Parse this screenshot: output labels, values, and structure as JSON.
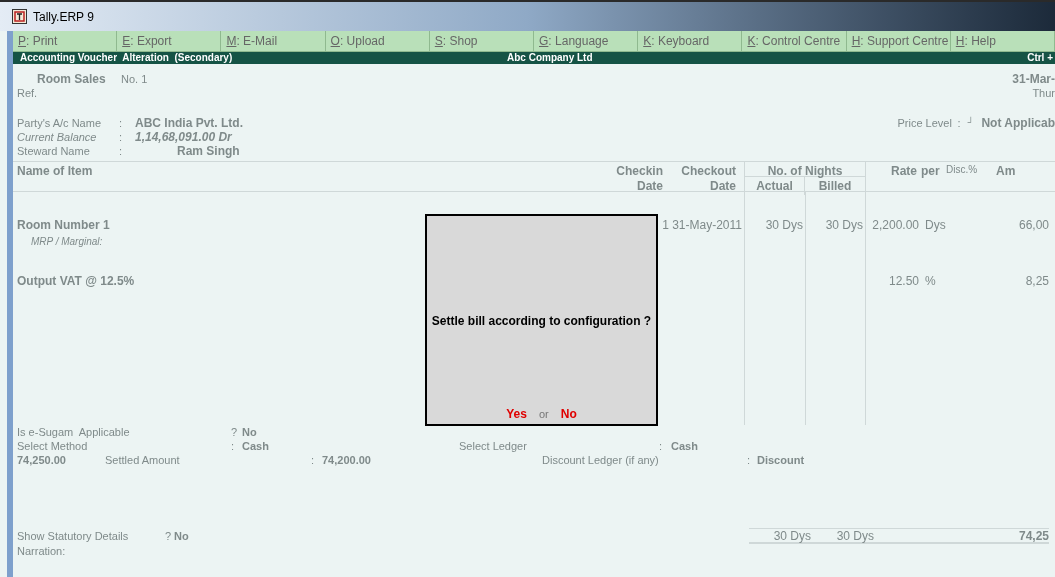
{
  "window": {
    "title": "Tally.ERP 9"
  },
  "button_bar": [
    {
      "key": "P",
      "label": ": Print"
    },
    {
      "key": "E",
      "label": ": Export"
    },
    {
      "key": "M",
      "label": ": E-Mail"
    },
    {
      "key": "O",
      "label": ": Upload"
    },
    {
      "key": "S",
      "label": ": Shop"
    },
    {
      "key": "G",
      "label": ": Language"
    },
    {
      "key": "K",
      "label": ": Keyboard"
    },
    {
      "key": "K",
      "label": ": Control Centre"
    },
    {
      "key": "H",
      "label": ": Support Centre"
    },
    {
      "key": "H",
      "label": ": Help"
    }
  ],
  "header": {
    "title": "Accounting Voucher  Alteration  (Secondary)",
    "company": "Abc Company Ltd",
    "shortcut": "Ctrl +"
  },
  "voucher": {
    "type": "Room Sales",
    "number": "No. 1",
    "ref": "Ref.",
    "date": "31-Mar-",
    "day": "Thur"
  },
  "party": [
    {
      "label": "Party's A/c Name",
      "sep": ":",
      "value": "ABC India Pvt. Ltd.",
      "kind": "plain"
    },
    {
      "label": "Current Balance",
      "sep": ":",
      "value": "1,14,68,091.00 Dr",
      "kind": "italic"
    },
    {
      "label": "Steward Name",
      "sep": ":",
      "value": "Ram Singh",
      "kind": "indented"
    }
  ],
  "price_level": {
    "label": "Price Level",
    "sep": ":",
    "mark": "┘",
    "value": "Not Applicab"
  },
  "table": {
    "columns": [
      {
        "lines": [
          "Name of Item"
        ]
      },
      {
        "lines": [
          "Checkin",
          "Date"
        ]
      },
      {
        "lines": [
          "Checkout",
          "Date"
        ]
      },
      {
        "group": "No. of Nights",
        "subs": [
          "Actual",
          "Billed"
        ]
      },
      {
        "lines": [
          "Rate"
        ]
      },
      {
        "lines": [
          "per"
        ]
      },
      {
        "lines": [
          "Disc.%"
        ]
      },
      {
        "lines": [
          "Am"
        ]
      }
    ],
    "rows": [
      {
        "name": "Room Number 1",
        "note": "MRP / Marginal:",
        "checkin": "1",
        "checkout": "31-May-2011",
        "actual": "30 Dys",
        "billed": "30 Dys",
        "rate": "2,200.00",
        "per": "Dys",
        "amount": "66,00"
      },
      {
        "name": "Output VAT @ 12.5%",
        "rate": "12.50",
        "per": "%",
        "amount": "8,25"
      }
    ]
  },
  "dialog": {
    "message": "Settle bill according to configuration ?",
    "options": [
      "Yes",
      "No"
    ],
    "separator": "or"
  },
  "settlement": {
    "esugam": {
      "label": "Is e-Sugam  Applicable",
      "sep": "?",
      "value": "No"
    },
    "method": {
      "label": "Select Method",
      "sep": ":",
      "value": "Cash"
    },
    "ledger": {
      "label": "Select Ledger",
      "sep": ":",
      "value": "Cash"
    },
    "amount": "74,250.00",
    "settled": {
      "label": "Settled Amount",
      "sep": ":",
      "value": "74,200.00"
    },
    "discount": {
      "label": "Discount Ledger (if any)",
      "sep": ":",
      "value": "Discount"
    }
  },
  "footer": {
    "statutory": {
      "label": "Show Statutory Details",
      "sep": "?",
      "value": "No"
    },
    "narration": "Narration:"
  },
  "totals": {
    "actual": "30 Dys",
    "billed": "30 Dys",
    "amount": "74,25"
  }
}
